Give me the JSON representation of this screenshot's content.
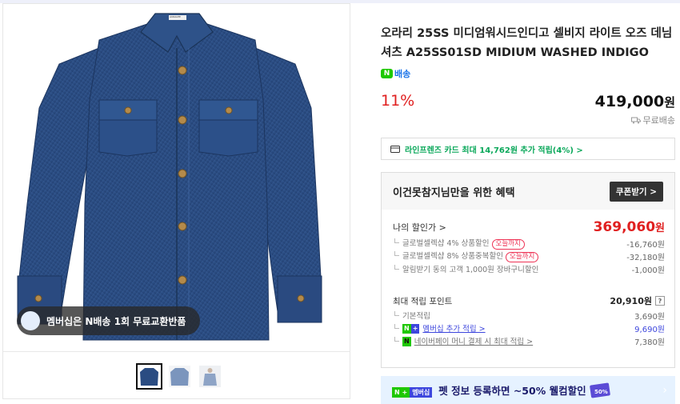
{
  "product": {
    "title": "오라리 25SS 미디엄워시드인디고 셀비지 라이트 오즈 데님 셔츠 A25SS01SD MIDIUM WASHED INDIGO",
    "delivery_badge": "배송",
    "discount_rate": "11%",
    "price": "419,000",
    "price_unit": "원",
    "shipping": "무료배송"
  },
  "gallery": {
    "membership_badge": "멤버십은 N배송 1회 무료교환반품",
    "collar_label": "AURALEE",
    "thumbnails": [
      "front",
      "back-light",
      "model"
    ]
  },
  "card_offer": {
    "label": "라인프렌즈 카드 최대 14,762원 추가 적립(4%) >"
  },
  "benefit": {
    "heading": "이건못참지님만을 위한 혜택",
    "coupon_button": "쿠폰받기 >",
    "my_price_label": "나의 할인가 >",
    "my_price_value": "369,060",
    "my_price_unit": "원",
    "discounts": [
      {
        "label": "글로벌셀렉샵 4% 상품할인",
        "tag": "오늘까지",
        "value": "-16,760원"
      },
      {
        "label": "글로벌셀렉샵 8% 상품중복할인",
        "tag": "오늘까지",
        "value": "-32,180원"
      },
      {
        "label": "알림받기 동의 고객 1,000원 장바구니할인",
        "tag": "",
        "value": "-1,000원"
      }
    ],
    "points_label": "최대 적립 포인트",
    "points_value": "20,910원",
    "points_help": "?",
    "points": [
      {
        "label": "기본적립",
        "value": "3,690원"
      },
      {
        "label": "멤버십 추가 적립 >",
        "value": "9,690원"
      },
      {
        "label": "네이버페이 머니 결제 시 최대 적립 >",
        "value": "7,380원"
      }
    ]
  },
  "promo": {
    "tag1": "N +",
    "tag2": "멤버십",
    "text": "펫 정보 등록하면 ~50% 웰컴할인",
    "sticker": "50%"
  },
  "colors": {
    "denim": "#2b4f86",
    "discount_red": "#e02020",
    "npay_green": "#1ec800",
    "membership_blue": "#3d46dd"
  }
}
